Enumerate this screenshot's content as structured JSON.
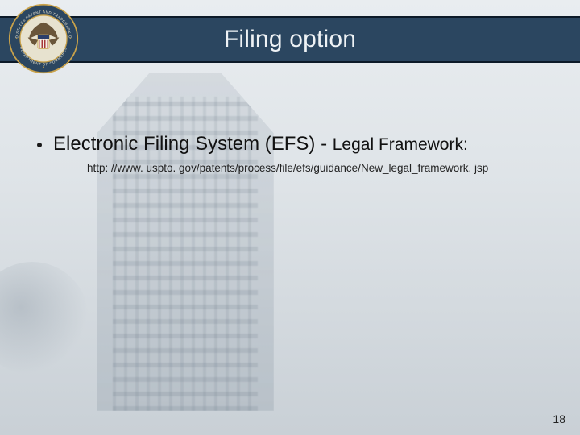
{
  "title": "Filing option",
  "seal": {
    "outer_text_top": "UNITED STATES PATENT AND TRADEMARK OFFICE",
    "outer_text_bottom": "DEPARTMENT OF COMMERCE",
    "colors": {
      "ring": "#2b4660",
      "gold": "#c9a24a",
      "shield_blue": "#2b3f6b",
      "shield_red": "#a12b2e",
      "shield_white": "#f4f1e6"
    }
  },
  "bullet": {
    "main": "Electronic Filing System (EFS) - ",
    "sub": "Legal Framework:"
  },
  "url": "http: //www. uspto. gov/patents/process/file/efs/guidance/New_legal_framework. jsp",
  "page_number": "18"
}
